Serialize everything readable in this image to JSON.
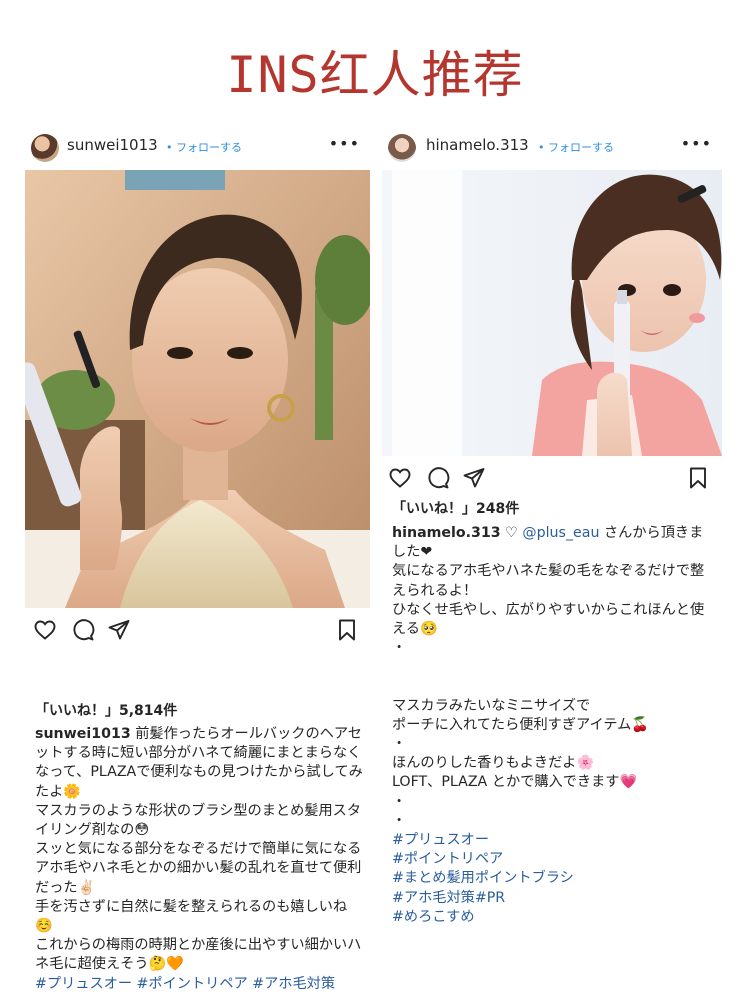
{
  "page": {
    "title": "INS红人推荐"
  },
  "posts": [
    {
      "username": "sunwei1013",
      "follow_label": "• フォローする",
      "more_label": "•••",
      "likes": "「いいね！」5,814件",
      "caption_user": "sunwei1013",
      "caption_lines": [
        " 前髪作ったらオールバックのヘアセットする時に短い部分がハネて綺麗にまとまらなくなって、PLAZAで便利なもの見つけたから試してみたよ🌼",
        "マスカラのような形状のブラシ型のまとめ髪用スタイリング剤なの😳",
        "スッと気になる部分をなぞるだけで簡単に気になるアホ毛やハネ毛とかの細かい髪の乱れを直せて便利だった✌🏻",
        "手を汚さずに自然に髪を整えられるのも嬉しいね☺️",
        "これからの梅雨の時期とか産後に出やすい細かいハネ毛に超使えそう🤔🧡"
      ],
      "hashtags": "#プリュスオー #ポイントリペア #アホ毛対策"
    },
    {
      "username": "hinamelo.313",
      "follow_label": "• フォローする",
      "more_label": "•••",
      "likes": "「いいね！」248件",
      "caption_user": "hinamelo.313",
      "caption_heart": " ♡ ",
      "caption_mention": "@plus_eau",
      "caption_first_rest": " さんから頂きました❤",
      "caption_lines": [
        "気になるアホ毛やハネた髪の毛をなぞるだけで整えられるよ！",
        "ひなくせ毛やし、広がりやすいからこれほんと使える🥺",
        "・",
        "",
        "マスカラみたいなミニサイズで",
        "ポーチに入れてたら便利すぎアイテム🍒",
        "・",
        "ほんのりした香りもよきだよ🌸",
        "LOFT、PLAZA とかで購入できます💗",
        "・",
        "・"
      ],
      "hashtags": [
        "#プリュスオー",
        "#ポイントリペア",
        "#まとめ髪用ポイントブラシ",
        "#アホ毛対策#PR",
        "#めろこすめ"
      ]
    }
  ]
}
